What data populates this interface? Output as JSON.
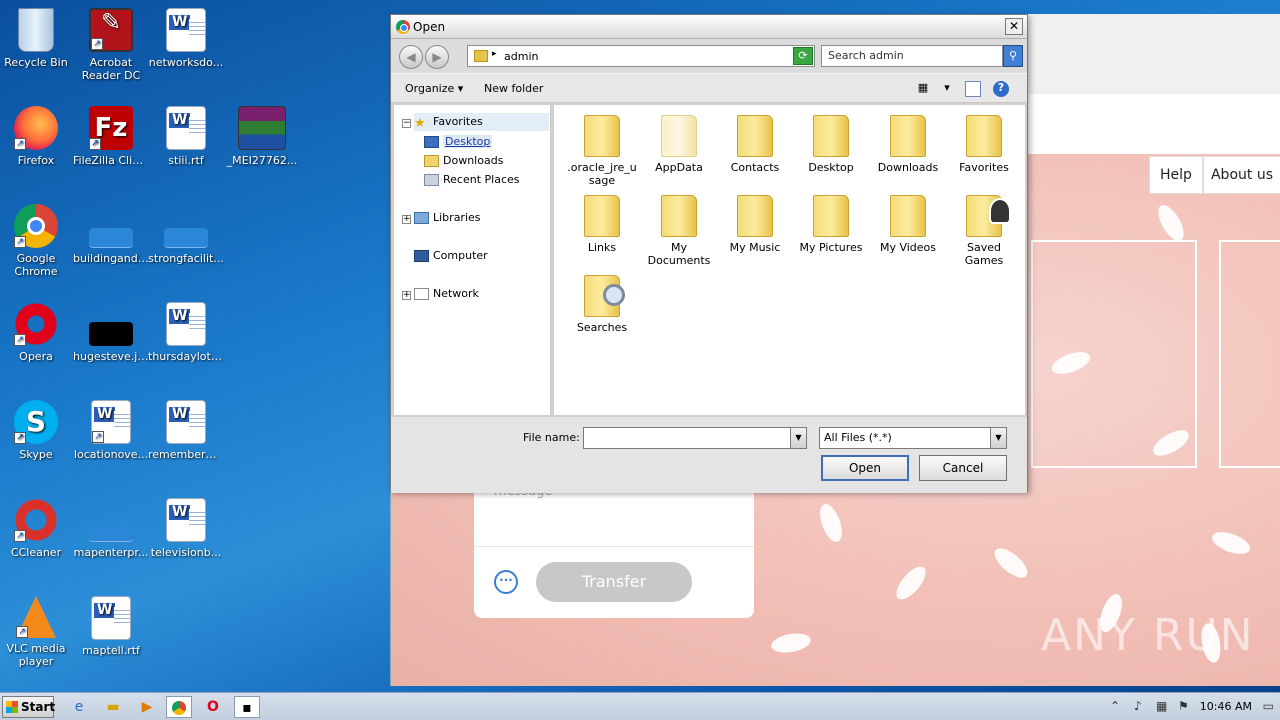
{
  "desktop": {
    "icons": [
      {
        "label": "Recycle Bin",
        "icon": "recycle-bin-icon"
      },
      {
        "label": "Acrobat Reader DC",
        "label1": "Acrobat",
        "label2": "Reader DC",
        "icon": "acrobat-icon"
      },
      {
        "label": "networksdo...",
        "icon": "word-doc-icon"
      },
      {
        "label": "Firefox",
        "icon": "firefox-icon"
      },
      {
        "label": "FileZilla Client",
        "icon": "filezilla-icon"
      },
      {
        "label": "stiii.rtf",
        "icon": "word-doc-icon"
      },
      {
        "label": "_MEI27762...",
        "icon": "winrar-icon"
      },
      {
        "label": "Google Chrome",
        "label1": "Google",
        "label2": "Chrome",
        "icon": "chrome-icon"
      },
      {
        "label": "buildingand....",
        "icon": "blank-image-icon"
      },
      {
        "label": "strongfacilit...",
        "icon": "blank-image-icon"
      },
      {
        "label": "Opera",
        "icon": "opera-icon"
      },
      {
        "label": "hugesteve.jpg",
        "icon": "black-image-icon"
      },
      {
        "label": "thursdaylot.rtf",
        "icon": "word-doc-icon"
      },
      {
        "label": "Skype",
        "icon": "skype-icon"
      },
      {
        "label": "locationove...",
        "icon": "word-doc-icon"
      },
      {
        "label": "rememberm...",
        "icon": "word-doc-icon"
      },
      {
        "label": "CCleaner",
        "icon": "ccleaner-icon"
      },
      {
        "label": "mapenterpr...",
        "icon": "blank-image-icon"
      },
      {
        "label": "televisionb...",
        "icon": "word-doc-icon"
      },
      {
        "label": "VLC media player",
        "label1": "VLC media",
        "label2": "player",
        "icon": "vlc-icon"
      },
      {
        "label": "maptell.rtf",
        "icon": "word-doc-icon"
      }
    ]
  },
  "browser": {
    "nav": {
      "help": "Help",
      "about": "About us"
    },
    "form": {
      "message_placeholder": "message",
      "transfer_button": "Transfer"
    },
    "watermark": "ANY RUN"
  },
  "dialog": {
    "title": "Open",
    "address": {
      "crumb": "admin"
    },
    "search_placeholder": "Search admin",
    "toolbar": {
      "organize": "Organize",
      "new_folder": "New folder"
    },
    "tree": {
      "favorites": "Favorites",
      "desktop": "Desktop",
      "downloads": "Downloads",
      "recent_places": "Recent Places",
      "libraries": "Libraries",
      "computer": "Computer",
      "network": "Network"
    },
    "files": [
      {
        "label": ".oracle_jre_usage",
        "l1": ".oracle_jre_u",
        "l2": "sage"
      },
      {
        "label": "AppData",
        "l1": "AppData",
        "l2": ""
      },
      {
        "label": "Contacts",
        "l1": "Contacts",
        "l2": ""
      },
      {
        "label": "Desktop",
        "l1": "Desktop",
        "l2": ""
      },
      {
        "label": "Downloads",
        "l1": "Downloads",
        "l2": ""
      },
      {
        "label": "Favorites",
        "l1": "Favorites",
        "l2": ""
      },
      {
        "label": "Links",
        "l1": "Links",
        "l2": ""
      },
      {
        "label": "My Documents",
        "l1": "My",
        "l2": "Documents"
      },
      {
        "label": "My Music",
        "l1": "My Music",
        "l2": ""
      },
      {
        "label": "My Pictures",
        "l1": "My Pictures",
        "l2": ""
      },
      {
        "label": "My Videos",
        "l1": "My Videos",
        "l2": ""
      },
      {
        "label": "Saved Games",
        "l1": "Saved",
        "l2": "Games"
      },
      {
        "label": "Searches",
        "l1": "Searches",
        "l2": ""
      }
    ],
    "file_name_label": "File name:",
    "file_name_value": "",
    "file_type": "All Files (*.*)",
    "open_button": "Open",
    "cancel_button": "Cancel"
  },
  "taskbar": {
    "start": "Start",
    "clock": "10:46 AM"
  }
}
